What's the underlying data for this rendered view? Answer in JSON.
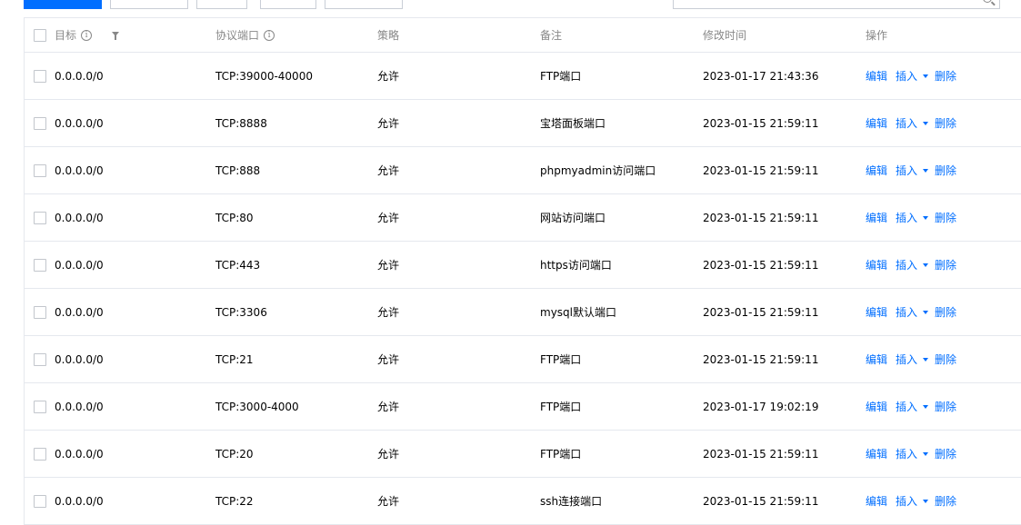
{
  "colors": {
    "primary": "#006eff",
    "allow": "#0abf5b",
    "header_text": "#888888",
    "border": "#e5e8ee"
  },
  "table": {
    "headers": {
      "target": "目标",
      "protocol_port": "协议端口",
      "policy": "策略",
      "remark": "备注",
      "modified_time": "修改时间",
      "operations": "操作"
    },
    "rows": [
      {
        "target": "0.0.0.0/0",
        "protocol_port": "TCP:39000-40000",
        "policy": "允许",
        "remark": "FTP端口",
        "modified_time": "2023-01-17 21:43:36"
      },
      {
        "target": "0.0.0.0/0",
        "protocol_port": "TCP:8888",
        "policy": "允许",
        "remark": "宝塔面板端口",
        "modified_time": "2023-01-15 21:59:11"
      },
      {
        "target": "0.0.0.0/0",
        "protocol_port": "TCP:888",
        "policy": "允许",
        "remark": "phpmyadmin访问端口",
        "modified_time": "2023-01-15 21:59:11"
      },
      {
        "target": "0.0.0.0/0",
        "protocol_port": "TCP:80",
        "policy": "允许",
        "remark": "网站访问端口",
        "modified_time": "2023-01-15 21:59:11"
      },
      {
        "target": "0.0.0.0/0",
        "protocol_port": "TCP:443",
        "policy": "允许",
        "remark": "https访问端口",
        "modified_time": "2023-01-15 21:59:11"
      },
      {
        "target": "0.0.0.0/0",
        "protocol_port": "TCP:3306",
        "policy": "允许",
        "remark": "mysql默认端口",
        "modified_time": "2023-01-15 21:59:11"
      },
      {
        "target": "0.0.0.0/0",
        "protocol_port": "TCP:21",
        "policy": "允许",
        "remark": "FTP端口",
        "modified_time": "2023-01-15 21:59:11"
      },
      {
        "target": "0.0.0.0/0",
        "protocol_port": "TCP:3000-4000",
        "policy": "允许",
        "remark": "FTP端口",
        "modified_time": "2023-01-17 19:02:19"
      },
      {
        "target": "0.0.0.0/0",
        "protocol_port": "TCP:20",
        "policy": "允许",
        "remark": "FTP端口",
        "modified_time": "2023-01-15 21:59:11"
      },
      {
        "target": "0.0.0.0/0",
        "protocol_port": "TCP:22",
        "policy": "允许",
        "remark": "ssh连接端口",
        "modified_time": "2023-01-15 21:59:11"
      }
    ],
    "ops": {
      "edit": "编辑",
      "insert": "插入",
      "delete": "删除"
    }
  }
}
